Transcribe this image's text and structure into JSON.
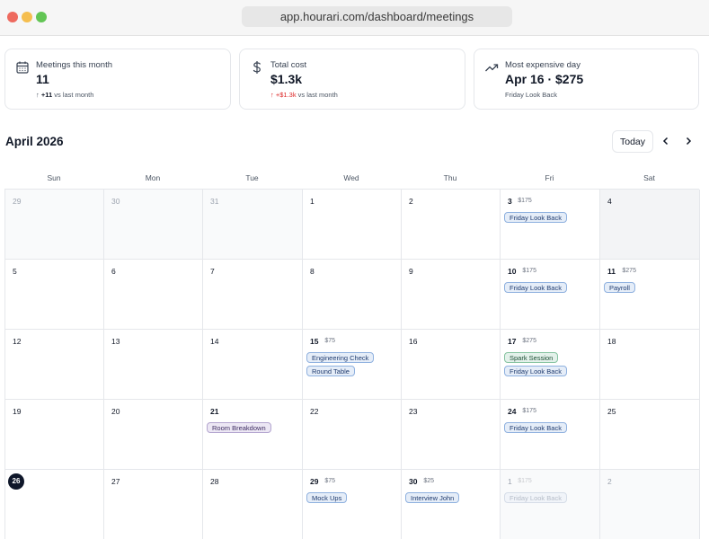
{
  "browser": {
    "url": "app.hourari.com/dashboard/meetings"
  },
  "stats": [
    {
      "label": "Meetings this month",
      "value": "11",
      "delta": "+11",
      "compare": "vs last month",
      "icon": "calendar-icon"
    },
    {
      "label": "Total cost",
      "value": "$1.3k",
      "delta": "+$1.3k",
      "compare": "vs last month",
      "icon": "dollar-icon"
    },
    {
      "label": "Most expensive day",
      "value": "Apr 16 · $275",
      "detail": "Friday Look Back",
      "icon": "trending-up-icon"
    }
  ],
  "calendar": {
    "month_label": "April 2026",
    "today_label": "Today",
    "weekdays": [
      "Sun",
      "Mon",
      "Tue",
      "Wed",
      "Thu",
      "Fri",
      "Sat"
    ],
    "days": [
      {
        "day": "29",
        "dim": true
      },
      {
        "day": "30",
        "dim": true
      },
      {
        "day": "31",
        "dim": true
      },
      {
        "day": "1"
      },
      {
        "day": "2"
      },
      {
        "day": "3",
        "cost": "$175",
        "events": [
          {
            "title": "Friday Look Back",
            "color": "blue"
          }
        ]
      },
      {
        "day": "4",
        "shade": true
      },
      {
        "day": "5"
      },
      {
        "day": "6"
      },
      {
        "day": "7"
      },
      {
        "day": "8"
      },
      {
        "day": "9"
      },
      {
        "day": "10",
        "cost": "$175",
        "events": [
          {
            "title": "Friday Look Back",
            "color": "blue"
          }
        ]
      },
      {
        "day": "11",
        "cost": "$275",
        "events": [
          {
            "title": "Payroll",
            "color": "blue"
          }
        ]
      },
      {
        "day": "12"
      },
      {
        "day": "13"
      },
      {
        "day": "14"
      },
      {
        "day": "15",
        "cost": "$75",
        "events": [
          {
            "title": "Engineering Check",
            "color": "blue"
          },
          {
            "title": "Round Table",
            "color": "blue"
          }
        ]
      },
      {
        "day": "16"
      },
      {
        "day": "17",
        "cost": "$275",
        "events": [
          {
            "title": "Spark Session",
            "color": "green"
          },
          {
            "title": "Friday Look Back",
            "color": "blue"
          }
        ]
      },
      {
        "day": "18"
      },
      {
        "day": "19"
      },
      {
        "day": "20"
      },
      {
        "day": "21",
        "events": [
          {
            "title": "Room Breakdown",
            "color": "purple"
          }
        ]
      },
      {
        "day": "22"
      },
      {
        "day": "23"
      },
      {
        "day": "24",
        "cost": "$175",
        "events": [
          {
            "title": "Friday Look Back",
            "color": "blue"
          }
        ]
      },
      {
        "day": "25"
      },
      {
        "day": "26",
        "today": true
      },
      {
        "day": "27"
      },
      {
        "day": "28"
      },
      {
        "day": "29",
        "cost": "$75",
        "events": [
          {
            "title": "Mock Ups",
            "color": "blue"
          }
        ]
      },
      {
        "day": "30",
        "cost": "$25",
        "events": [
          {
            "title": "Interview John",
            "color": "blue"
          }
        ]
      },
      {
        "day": "1",
        "dim": true,
        "cost": "$175",
        "events": [
          {
            "title": "Friday Look Back",
            "color": "faded"
          }
        ]
      },
      {
        "day": "2",
        "dim": true
      }
    ]
  },
  "colors": {
    "accent": "#0f172a",
    "negative": "#dc2626",
    "event_blue": "#8fb1df",
    "event_green": "#86c3a1",
    "event_purple": "#b3a5cf"
  }
}
